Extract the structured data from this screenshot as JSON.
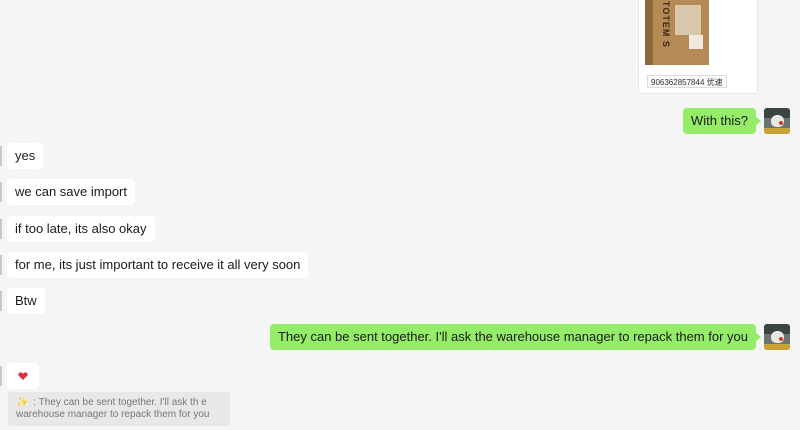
{
  "image_message": {
    "photo_text": "TOTEM S",
    "tracking_label": "9063628578​44 优速"
  },
  "outgoing": [
    {
      "id": "with-this",
      "text": "With this?"
    },
    {
      "id": "sent-together",
      "text": "They can be sent together. I'll ask the warehouse manager to repack them for you"
    }
  ],
  "incoming": [
    {
      "text": "yes"
    },
    {
      "text": "we can save import"
    },
    {
      "text": "if too late, its also okay"
    },
    {
      "text": "for me, its just important to receive it all very soon"
    },
    {
      "text": "Btw"
    }
  ],
  "sticker": {
    "icon": "heart-sticker-icon",
    "color": "#d9343b"
  },
  "quote": {
    "sparkle": "✨",
    "text": "They can be sent together. I'll ask th e warehouse manager to repack them for you",
    "prefix": " : "
  },
  "colors": {
    "background": "#f5f5f5",
    "outgoing_bubble": "#95ec69",
    "incoming_bubble": "#ffffff"
  }
}
